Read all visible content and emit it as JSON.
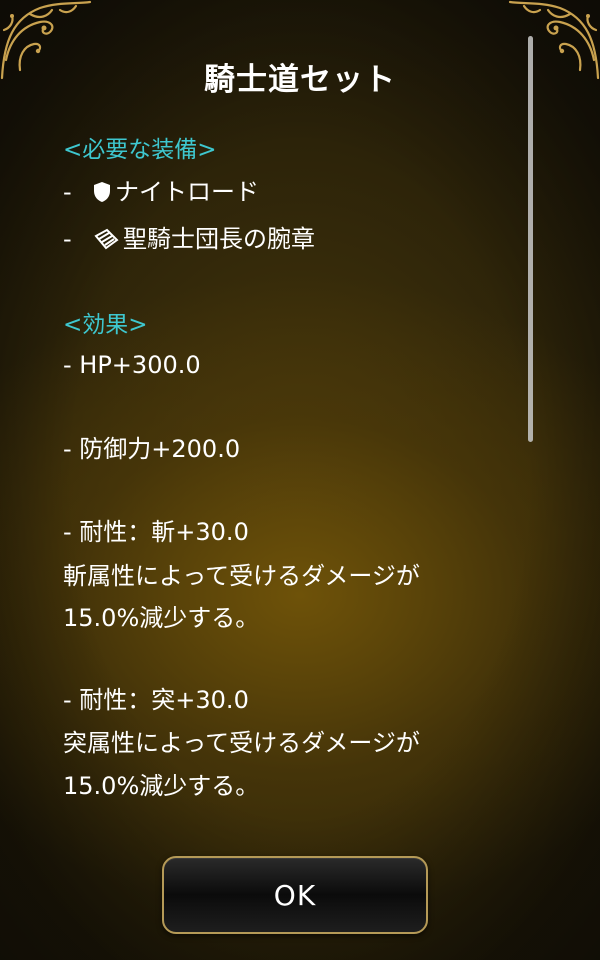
{
  "title": "騎士道セット",
  "required_heading": "<必要な装備>",
  "equipment": [
    {
      "dash": "-",
      "icon": "shield-icon",
      "label": "ナイトロード"
    },
    {
      "dash": "-",
      "icon": "armband-icon",
      "label": "聖騎士団長の腕章"
    }
  ],
  "effects_heading": "<効果>",
  "effects": {
    "hp": "-  HP+300.0",
    "defense": "-  防御力+200.0",
    "slash_title": "-  耐性：斬+30.0",
    "slash_desc_1": "斬属性によって受けるダメージが",
    "slash_desc_2": "15.0%減少する。",
    "pierce_title": "-  耐性：突+30.0",
    "pierce_desc_1": "突属性によって受けるダメージが",
    "pierce_desc_2": "15.0%減少する。"
  },
  "ok_label": "OK",
  "colors": {
    "heading": "#3ec7cf",
    "button_border": "#b59a57",
    "ornament": "#c9a24f"
  }
}
